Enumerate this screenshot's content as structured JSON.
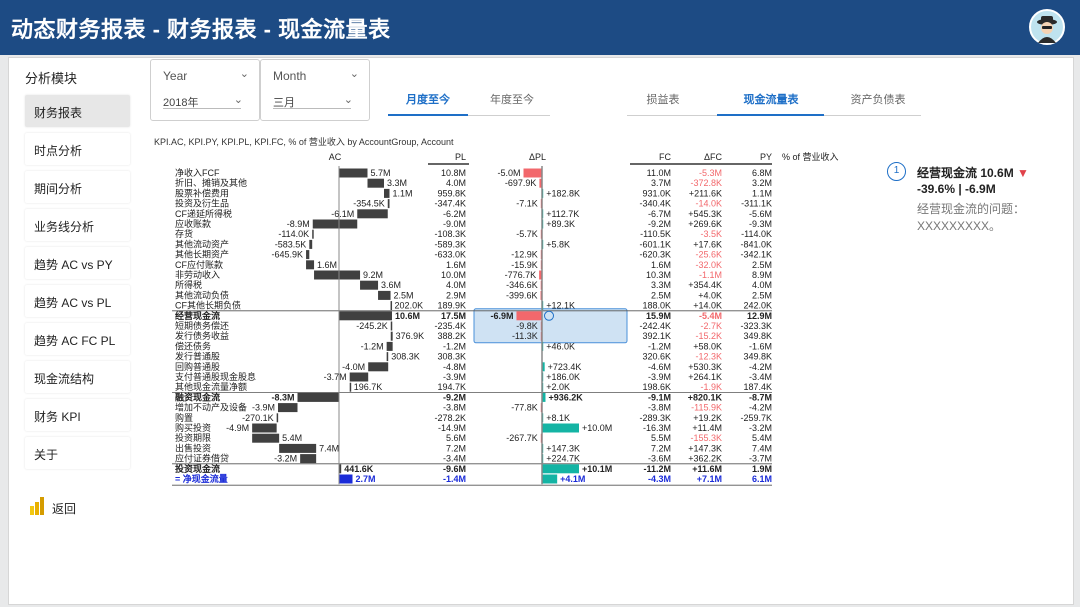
{
  "app": {
    "title": "动态财务报表 - 财务报表 - 现金流量表"
  },
  "sidebar": {
    "header": "分析模块",
    "active": 0,
    "items": [
      "财务报表",
      "时点分析",
      "期间分析",
      "业务线分析",
      "趋势 AC vs PY",
      "趋势 AC vs PL",
      "趋势 AC FC PL",
      "现金流结构",
      "财务 KPI",
      "关于"
    ],
    "back": "返回"
  },
  "filters": {
    "year": {
      "label": "Year",
      "value": "2018年"
    },
    "month": {
      "label": "Month",
      "value": "三月"
    }
  },
  "period_tabs": {
    "items": [
      "月度至今",
      "年度至今"
    ],
    "active": 0
  },
  "report_tabs": {
    "items": [
      "损益表",
      "现金流量表",
      "资产负债表"
    ],
    "active": 1
  },
  "table": {
    "title": "KPI.AC, KPI.PY, KPI.PL, KPI.FC, % of 营业收入 by AccountGroup, Account",
    "headers": {
      "ac": "AC",
      "pl": "PL",
      "dpl": "ΔPL",
      "fc": "FC",
      "dfc": "ΔFC",
      "py": "PY",
      "pct": "% of 营业收入"
    },
    "rows": [
      {
        "name": "净收入FCF",
        "ac": "5.7M",
        "acv": 5.7,
        "pl": "10.8M",
        "dpl": "-5.0M",
        "dplv": -5.0,
        "fc": "11.0M",
        "dfc": "-5.3M",
        "py": "6.8M"
      },
      {
        "name": "折旧、摊销及其他",
        "ac": "3.3M",
        "acv": 3.3,
        "pl": "4.0M",
        "dpl": "-697.9K",
        "dplv": -0.7,
        "fc": "3.7M",
        "dfc": "-372.8K",
        "py": "3.2M"
      },
      {
        "name": "股票补偿费用",
        "ac": "1.1M",
        "acv": 1.1,
        "pl": "959.8K",
        "dpl": "+182.8K",
        "dplv": 0.18,
        "fc": "931.0K",
        "dfc": "+211.6K",
        "py": "1.1M"
      },
      {
        "name": "投资及衍生品",
        "ac": "-354.5K",
        "acv": -0.35,
        "pl": "-347.4K",
        "dpl": "-7.1K",
        "dplv": -0.01,
        "fc": "-340.4K",
        "dfc": "-14.0K",
        "py": "-311.1K"
      },
      {
        "name": "CF递延所得税",
        "ac": "-6.1M",
        "acv": -6.1,
        "pl": "-6.2M",
        "dpl": "+112.7K",
        "dplv": 0.11,
        "fc": "-6.7M",
        "dfc": "+545.3K",
        "py": "-5.6M"
      },
      {
        "name": "应收账款",
        "ac": "-8.9M",
        "acv": -8.9,
        "pl": "-9.0M",
        "dpl": "+89.3K",
        "dplv": 0.09,
        "fc": "-9.2M",
        "dfc": "+269.6K",
        "py": "-9.3M"
      },
      {
        "name": "存货",
        "ac": "-114.0K",
        "acv": -0.11,
        "pl": "-108.3K",
        "dpl": "-5.7K",
        "dplv": -0.01,
        "fc": "-110.5K",
        "dfc": "-3.5K",
        "py": "-114.0K"
      },
      {
        "name": "其他流动资产",
        "ac": "-583.5K",
        "acv": -0.58,
        "pl": "-589.3K",
        "dpl": "+5.8K",
        "dplv": 0.01,
        "fc": "-601.1K",
        "dfc": "+17.6K",
        "py": "-841.0K"
      },
      {
        "name": "其他长期资产",
        "ac": "-645.9K",
        "acv": -0.65,
        "pl": "-633.0K",
        "dpl": "-12.9K",
        "dplv": -0.01,
        "fc": "-620.3K",
        "dfc": "-25.6K",
        "py": "-342.1K"
      },
      {
        "name": "CF应付账款",
        "ac": "1.6M",
        "acv": 1.6,
        "pl": "1.6M",
        "dpl": "-15.9K",
        "dplv": -0.02,
        "fc": "1.6M",
        "dfc": "-32.0K",
        "py": "2.5M"
      },
      {
        "name": "非劳动收入",
        "ac": "9.2M",
        "acv": 9.2,
        "pl": "10.0M",
        "dpl": "-776.7K",
        "dplv": -0.78,
        "fc": "10.3M",
        "dfc": "-1.1M",
        "py": "8.9M"
      },
      {
        "name": "所得税",
        "ac": "3.6M",
        "acv": 3.6,
        "pl": "4.0M",
        "dpl": "-346.6K",
        "dplv": -0.35,
        "fc": "3.3M",
        "dfc": "+354.4K",
        "py": "4.0M"
      },
      {
        "name": "其他流动负债",
        "ac": "2.5M",
        "acv": 2.5,
        "pl": "2.9M",
        "dpl": "-399.6K",
        "dplv": -0.4,
        "fc": "2.5M",
        "dfc": "+4.0K",
        "py": "2.5M"
      },
      {
        "name": "CF其他长期负债",
        "ac": "202.0K",
        "acv": 0.2,
        "pl": "189.9K",
        "dpl": "+12.1K",
        "dplv": 0.01,
        "fc": "188.0K",
        "dfc": "+14.0K",
        "py": "242.0K"
      },
      {
        "name": "经营现金流",
        "ac": "10.6M",
        "acv": 10.6,
        "pl": "17.5M",
        "dpl": "-6.9M",
        "dplv": -6.9,
        "fc": "15.9M",
        "dfc": "-5.4M",
        "py": "12.9M",
        "total": true,
        "selected": true
      },
      {
        "name": "短期债务偿还",
        "ac": "-245.2K",
        "acv": -0.25,
        "pl": "-235.4K",
        "dpl": "-9.8K",
        "dplv": -0.01,
        "fc": "-242.4K",
        "dfc": "-2.7K",
        "py": "-323.3K"
      },
      {
        "name": "发行债务收益",
        "ac": "376.9K",
        "acv": 0.38,
        "pl": "388.2K",
        "dpl": "-11.3K",
        "dplv": -0.01,
        "fc": "392.1K",
        "dfc": "-15.2K",
        "py": "349.8K"
      },
      {
        "name": "偿还债务",
        "ac": "-1.2M",
        "acv": -1.2,
        "pl": "-1.2M",
        "dpl": "+46.0K",
        "dplv": 0.05,
        "fc": "-1.2M",
        "dfc": "+58.0K",
        "py": "-1.6M"
      },
      {
        "name": "发行普通股",
        "ac": "308.3K",
        "acv": 0.31,
        "pl": "308.3K",
        "dpl": "",
        "dplv": 0,
        "fc": "320.6K",
        "dfc": "-12.3K",
        "py": "349.8K"
      },
      {
        "name": "回购普通股",
        "ac": "-4.0M",
        "acv": -4.0,
        "pl": "-4.8M",
        "dpl": "+723.4K",
        "dplv": 0.72,
        "fc": "-4.6M",
        "dfc": "+530.3K",
        "py": "-4.2M"
      },
      {
        "name": "支付普通股现金股息",
        "ac": "-3.7M",
        "acv": -3.7,
        "pl": "-3.9M",
        "dpl": "+186.0K",
        "dplv": 0.19,
        "fc": "-3.9M",
        "dfc": "+264.1K",
        "py": "-3.4M"
      },
      {
        "name": "其他现金流量净额",
        "ac": "196.7K",
        "acv": 0.2,
        "pl": "194.7K",
        "dpl": "+2.0K",
        "dplv": 0.0,
        "fc": "198.6K",
        "dfc": "-1.9K",
        "py": "187.4K"
      },
      {
        "name": "融资现金流",
        "ac": "-8.3M",
        "acv": -8.3,
        "pl": "-9.2M",
        "dpl": "+936.2K",
        "dplv": 0.94,
        "fc": "-9.1M",
        "dfc": "+820.1K",
        "py": "-8.7M",
        "total": true
      },
      {
        "name": "增加不动产及设备",
        "ac": "-3.9M",
        "acv": -3.9,
        "pl": "-3.8M",
        "dpl": "-77.8K",
        "dplv": -0.08,
        "fc": "-3.8M",
        "dfc": "-115.9K",
        "py": "-4.2M"
      },
      {
        "name": "购置",
        "ac": "-270.1K",
        "acv": -0.27,
        "pl": "-278.2K",
        "dpl": "+8.1K",
        "dplv": 0.01,
        "fc": "-289.3K",
        "dfc": "+19.2K",
        "py": "-259.7K"
      },
      {
        "name": "购买投资",
        "ac": "-4.9M",
        "acv": -4.9,
        "pl": "-14.9M",
        "dpl": "+10.0M",
        "dplv": 10.0,
        "fc": "-16.3M",
        "dfc": "+11.4M",
        "py": "-3.2M"
      },
      {
        "name": "投资期限",
        "ac": "5.4M",
        "acv": 5.4,
        "pl": "5.6M",
        "dpl": "-267.7K",
        "dplv": -0.27,
        "fc": "5.5M",
        "dfc": "-155.3K",
        "py": "5.4M"
      },
      {
        "name": "出售投资",
        "ac": "7.4M",
        "acv": 7.4,
        "pl": "7.2M",
        "dpl": "+147.3K",
        "dplv": 0.15,
        "fc": "7.2M",
        "dfc": "+147.3K",
        "py": "7.4M"
      },
      {
        "name": "应付证券借贷",
        "ac": "-3.2M",
        "acv": -3.2,
        "pl": "-3.4M",
        "dpl": "+224.7K",
        "dplv": 0.22,
        "fc": "-3.6M",
        "dfc": "+362.2K",
        "py": "-3.7M"
      },
      {
        "name": "投资现金流",
        "ac": "441.6K",
        "acv": 0.44,
        "pl": "-9.6M",
        "dpl": "+10.1M",
        "dplv": 10.1,
        "fc": "-11.2M",
        "dfc": "+11.6M",
        "py": "1.9M",
        "total": true
      },
      {
        "name": "= 净现金流量",
        "ac": "2.7M",
        "acv": 2.7,
        "pl": "-1.4M",
        "dpl": "+4.1M",
        "dplv": 4.1,
        "fc": "-4.3M",
        "dfc": "+7.1M",
        "py": "6.1M",
        "net": true
      }
    ]
  },
  "kpi": {
    "num": "1",
    "line1": "经营现金流 10.6M",
    "arrow": "▼",
    "line2": "-39.6% | -6.9M",
    "line3": "经营现金流的问题：",
    "line4": "XXXXXXXXX。"
  },
  "colors": {
    "brand": "#1d4b84",
    "accent": "#1e6fc7",
    "bar": "#404040",
    "neg": "#f2686c",
    "pos": "#14b4a4",
    "net": "#1a2bd8"
  }
}
